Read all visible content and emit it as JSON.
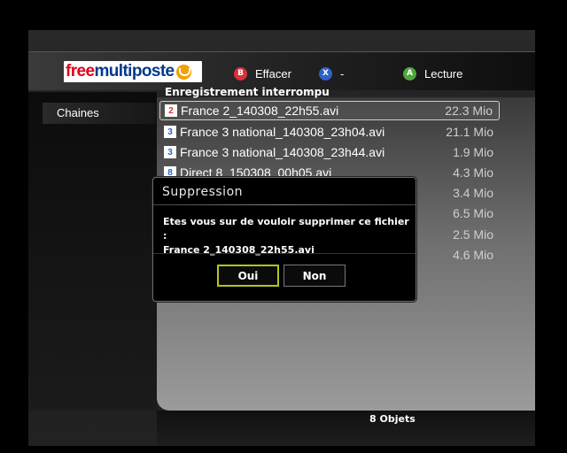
{
  "header": {
    "logo_free": "free",
    "logo_multiposte": "multiposte",
    "hints": [
      {
        "key": "B",
        "label": "Effacer",
        "color": "#d8323a"
      },
      {
        "key": "X",
        "label": "-",
        "color": "#2c63c8"
      },
      {
        "key": "A",
        "label": "Lecture",
        "color": "#4ea83a"
      }
    ]
  },
  "sidebar": {
    "items": [
      {
        "label": "Chaines"
      }
    ]
  },
  "list": {
    "title": "Enregistrement interrompu",
    "rows": [
      {
        "channel": "2",
        "channel_color": "#d8323a",
        "name": "France 2_140308_22h55.avi",
        "size": "22.3 Mio"
      },
      {
        "channel": "3",
        "channel_color": "#2c63c8",
        "name": "France 3 national_140308_23h04.avi",
        "size": "21.1 Mio"
      },
      {
        "channel": "3",
        "channel_color": "#2c63c8",
        "name": "France 3 national_140308_23h44.avi",
        "size": "1.9 Mio"
      },
      {
        "channel": "8",
        "channel_color": "#2c63c8",
        "name": "Direct 8_150308_00h05.avi",
        "size": "4.3 Mio"
      },
      {
        "channel": "",
        "channel_color": "",
        "name": "",
        "size": "3.4 Mio"
      },
      {
        "channel": "",
        "channel_color": "",
        "name": "",
        "size": "6.5 Mio"
      },
      {
        "channel": "",
        "channel_color": "",
        "name": "",
        "size": "2.5 Mio"
      },
      {
        "channel": "",
        "channel_color": "",
        "name": "",
        "size": "4.6 Mio"
      }
    ]
  },
  "footer": {
    "count": "8 Objets"
  },
  "dialog": {
    "title": "Suppression",
    "message_line1": "Etes vous sur de vouloir supprimer ce fichier :",
    "message_line2": "France 2_140308_22h55.avi",
    "yes_label": "Oui",
    "no_label": "Non"
  },
  "colors": {
    "focus_accent": "#b7c51a"
  }
}
